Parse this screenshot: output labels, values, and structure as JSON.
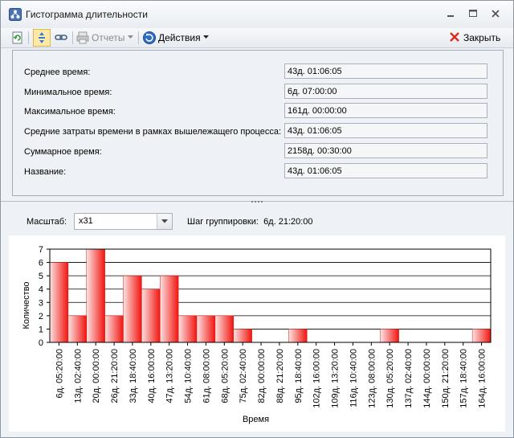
{
  "window": {
    "title": "Гистограмма длительности"
  },
  "toolbar": {
    "reports_label": "Отчеты",
    "actions_label": "Действия",
    "close_label": "Закрыть"
  },
  "fields": [
    {
      "label": "Среднее время:",
      "value": "43д. 01:06:05"
    },
    {
      "label": "Минимальное время:",
      "value": "6д. 07:00:00"
    },
    {
      "label": "Максимальное время:",
      "value": "161д. 00:00:00"
    },
    {
      "label": "Средние затраты времени в рамках вышележащего процесса:",
      "value": "43д. 01:06:05"
    },
    {
      "label": "Суммарное время:",
      "value": "2158д. 00:30:00"
    },
    {
      "label": "Название:",
      "value": "43д. 01:06:05"
    }
  ],
  "controls": {
    "scale_label": "Масштаб:",
    "scale_value": "x31",
    "step_label": "Шаг группировки:",
    "step_value": "6д. 21:20:00"
  },
  "colors": {
    "bar_light": "#fbe3e3",
    "bar_dark": "#f2140f",
    "selected_tool": "#ffe9a6"
  },
  "chart_data": {
    "type": "bar",
    "categories": [
      "6д. 05:20:00",
      "13д. 02:40:00",
      "20д. 00:00:00",
      "26д. 21:20:00",
      "33д. 18:40:00",
      "40д. 16:00:00",
      "47д. 13:20:00",
      "54д. 10:40:00",
      "61д. 08:00:00",
      "68д. 05:20:00",
      "75д. 02:40:00",
      "82д. 00:00:00",
      "88д. 21:20:00",
      "95д. 18:40:00",
      "102д. 16:00:00",
      "109д. 13:20:00",
      "116д. 10:40:00",
      "123д. 08:00:00",
      "130д. 05:20:00",
      "137д. 02:40:00",
      "144д. 00:00:00",
      "150д. 21:20:00",
      "157д. 18:40:00",
      "164д. 16:00:00"
    ],
    "values": [
      6,
      2,
      7,
      2,
      5,
      4,
      5,
      2,
      2,
      2,
      1,
      0,
      0,
      1,
      0,
      0,
      0,
      0,
      1,
      0,
      0,
      0,
      0,
      1
    ],
    "xlabel": "Время",
    "ylabel": "Количество",
    "ylim": [
      0,
      7
    ],
    "yticks": [
      "0",
      "1",
      "2",
      "3",
      "4",
      "5",
      "6",
      "7"
    ],
    "grid": true
  }
}
